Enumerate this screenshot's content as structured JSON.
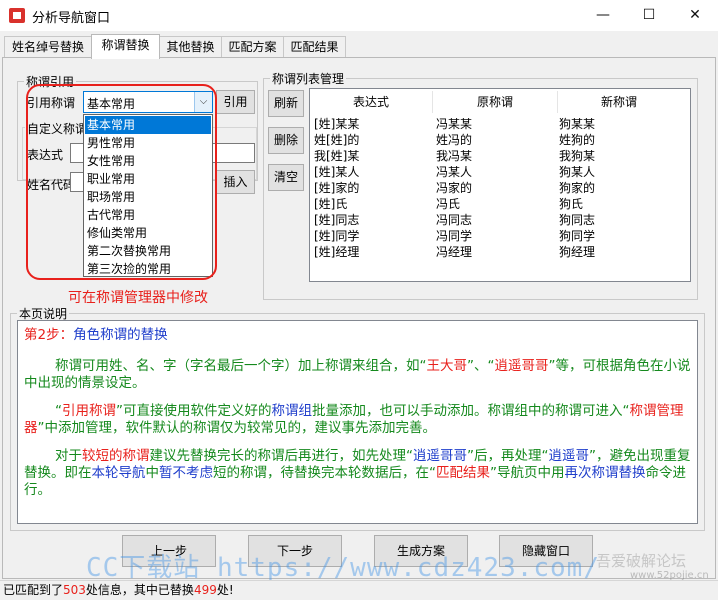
{
  "window": {
    "title": "分析导航窗口",
    "minimize": "—",
    "maximize": "☐",
    "close": "✕"
  },
  "tabs": [
    "姓名绰号替换",
    "称谓替换",
    "其他替换",
    "匹配方案",
    "匹配结果"
  ],
  "title_ref": {
    "group_label": "称谓引用",
    "ref_label": "引用称谓",
    "combo_value": "基本常用",
    "ref_button": "引用",
    "custom_label": "自定义称谓",
    "expr_label": "表达式",
    "name_code_label": "姓名代码",
    "insert_button": "插入",
    "dropdown_items": [
      "基本常用",
      "男性常用",
      "女性常用",
      "职业常用",
      "职场常用",
      "古代常用",
      "修仙类常用",
      "第二次替换常用",
      "第三次捡的常用"
    ],
    "selected_index": 0
  },
  "note": "可在称谓管理器中修改",
  "list_mgmt": {
    "group_label": "称谓列表管理",
    "refresh_button": "刷新",
    "delete_button": "删除",
    "clear_button": "清空",
    "columns": [
      "表达式",
      "原称谓",
      "新称谓"
    ],
    "rows": [
      [
        "[姓]某某",
        "冯某某",
        "狗某某"
      ],
      [
        "姓[姓]的",
        "姓冯的",
        "姓狗的"
      ],
      [
        "我[姓]某",
        "我冯某",
        "我狗某"
      ],
      [
        "[姓]某人",
        "冯某人",
        "狗某人"
      ],
      [
        "[姓]家的",
        "冯家的",
        "狗家的"
      ],
      [
        "[姓]氏",
        "冯氏",
        "狗氏"
      ],
      [
        "[姓]同志",
        "冯同志",
        "狗同志"
      ],
      [
        "[姓]同学",
        "冯同学",
        "狗同学"
      ],
      [
        "[姓]经理",
        "冯经理",
        "狗经理"
      ]
    ]
  },
  "explain": {
    "group_label": "本页说明",
    "step": "第2步：",
    "step_title": "角色称谓的替换",
    "p1": [
      "称谓可用姓、名、字（字名最后一个字）加上称谓来组合，如“",
      "王大哥",
      "”、“",
      "逍遥哥哥",
      "”等，可根据角色在小说中出现的情景设定。"
    ],
    "p2": [
      "“",
      "引用称谓",
      "”可直接使用软件定义好的",
      "称谓组",
      "批量添加，也可以手动添加。称谓组中的称谓可进入“",
      "称谓管理器",
      "”中添加管理，软件默认的称谓仅为较常见的，建议事先添加完善。"
    ],
    "p3": [
      "对于",
      "较短的称谓",
      "建议先替换完长的称谓后再进行，如先处理“",
      "逍遥哥哥",
      "”后，再处理“",
      "逍遥哥",
      "”，避免出现重复替换。即在",
      "本轮导航",
      "中",
      "暂不考虑",
      "短的称谓，待替换完本轮数据后，在“",
      "匹配结果",
      "”导航页中用",
      "再次称谓替换",
      "命令进行。"
    ]
  },
  "footer": {
    "prev_button": "上一步",
    "next_button": "下一步",
    "gen_button": "生成方案",
    "hide_button": "隐藏窗口"
  },
  "status": {
    "prefix": "已匹配到了",
    "matched": "503",
    "middle": "处信息，其中已替换",
    "replaced": "499",
    "suffix": "处!"
  },
  "watermark": {
    "main": "CC下载站 https://www.cdz423.com/",
    "forum": "吾爱破解论坛",
    "forum_url": "www.52pojie.cn"
  }
}
